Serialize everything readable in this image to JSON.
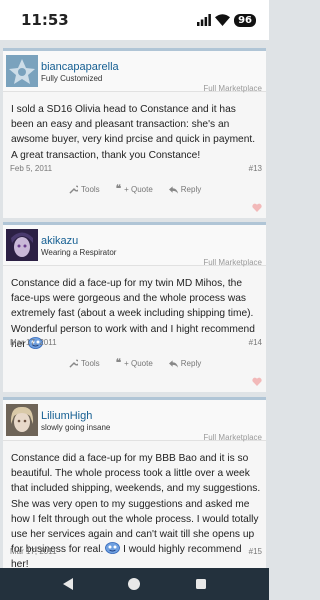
{
  "status": {
    "time": "11:53",
    "battery": "96"
  },
  "posts": [
    {
      "username": "biancapaparella",
      "usertitle": "Fully Customized",
      "forum": "Full Marketplace",
      "body": "I sold a SD16 Olivia head to Constance and it has been an easy and pleasant transaction: she's an awsome buyer, very kind prcise and quick in payment. A great transaction, thank you Constance!",
      "date": "Feb 5, 2011",
      "number": "#13",
      "tools": "Tools",
      "quote": "+ Quote",
      "reply": "Reply"
    },
    {
      "username": "akikazu",
      "usertitle": "Wearing a Respirator",
      "forum": "Full Marketplace",
      "body": "Constance did a face-up for my twin MD Mihos, the face-ups were gorgeous and the whole process was extremely fast (about a week including shipping time). Wonderful person to work with and I hight recommend her",
      "date": "Mar 17, 2011",
      "number": "#14",
      "tools": "Tools",
      "quote": "+ Quote",
      "reply": "Reply"
    },
    {
      "username": "LiliumHigh",
      "usertitle": "slowly going insane",
      "forum": "Full Marketplace",
      "body1": "Constance did a face-up for my BBB Bao and it is so beautiful. The whole process took a little over a week that included shipping, weekends, and my suggestions. She was very open to my suggestions and asked me how I felt through out the whole process. I would totally use her services again and can't wait till she opens up for business for real.",
      "body2": "I would highly recommend her!",
      "date": "Mar 17, 2011",
      "number": "#15"
    }
  ],
  "icons": {
    "wifi": "wifi-icon",
    "signal": "signal-icon",
    "tools": "wrench-icon",
    "quote": "quote-icon",
    "reply": "reply-icon",
    "like": "heart-icon",
    "smiley": "smiley-icon"
  },
  "colors": {
    "accent": "#176093",
    "header_border": "#b0c5d6",
    "nav_bar": "#23313d"
  }
}
